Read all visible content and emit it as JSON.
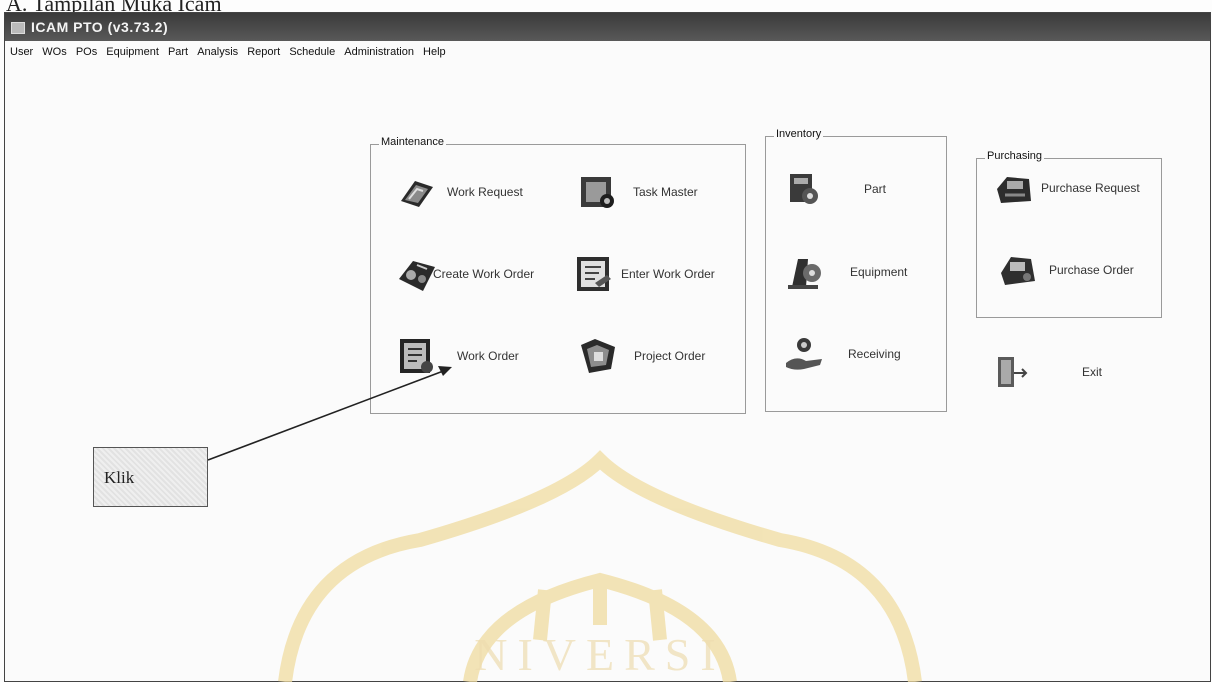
{
  "document": {
    "heading": "A. Tampilan Muka Icam"
  },
  "window": {
    "title": "ICAM PTO (v3.73.2)",
    "menu": [
      "User",
      "WOs",
      "POs",
      "Equipment",
      "Part",
      "Analysis",
      "Report",
      "Schedule",
      "Administration",
      "Help"
    ]
  },
  "groups": {
    "maintenance": {
      "title": "Maintenance",
      "items": {
        "work_request": "Work Request",
        "task_master": "Task Master",
        "create_work_order": "Create Work Order",
        "enter_work_order": "Enter Work Order",
        "work_order": "Work Order",
        "project_order": "Project Order"
      }
    },
    "inventory": {
      "title": "Inventory",
      "items": {
        "part": "Part",
        "equipment": "Equipment",
        "receiving": "Receiving"
      }
    },
    "purchasing": {
      "title": "Purchasing",
      "items": {
        "purchase_request": "Purchase Request",
        "purchase_order": "Purchase Order"
      }
    }
  },
  "exit": {
    "label": "Exit"
  },
  "annotation": {
    "label": "Klik"
  }
}
